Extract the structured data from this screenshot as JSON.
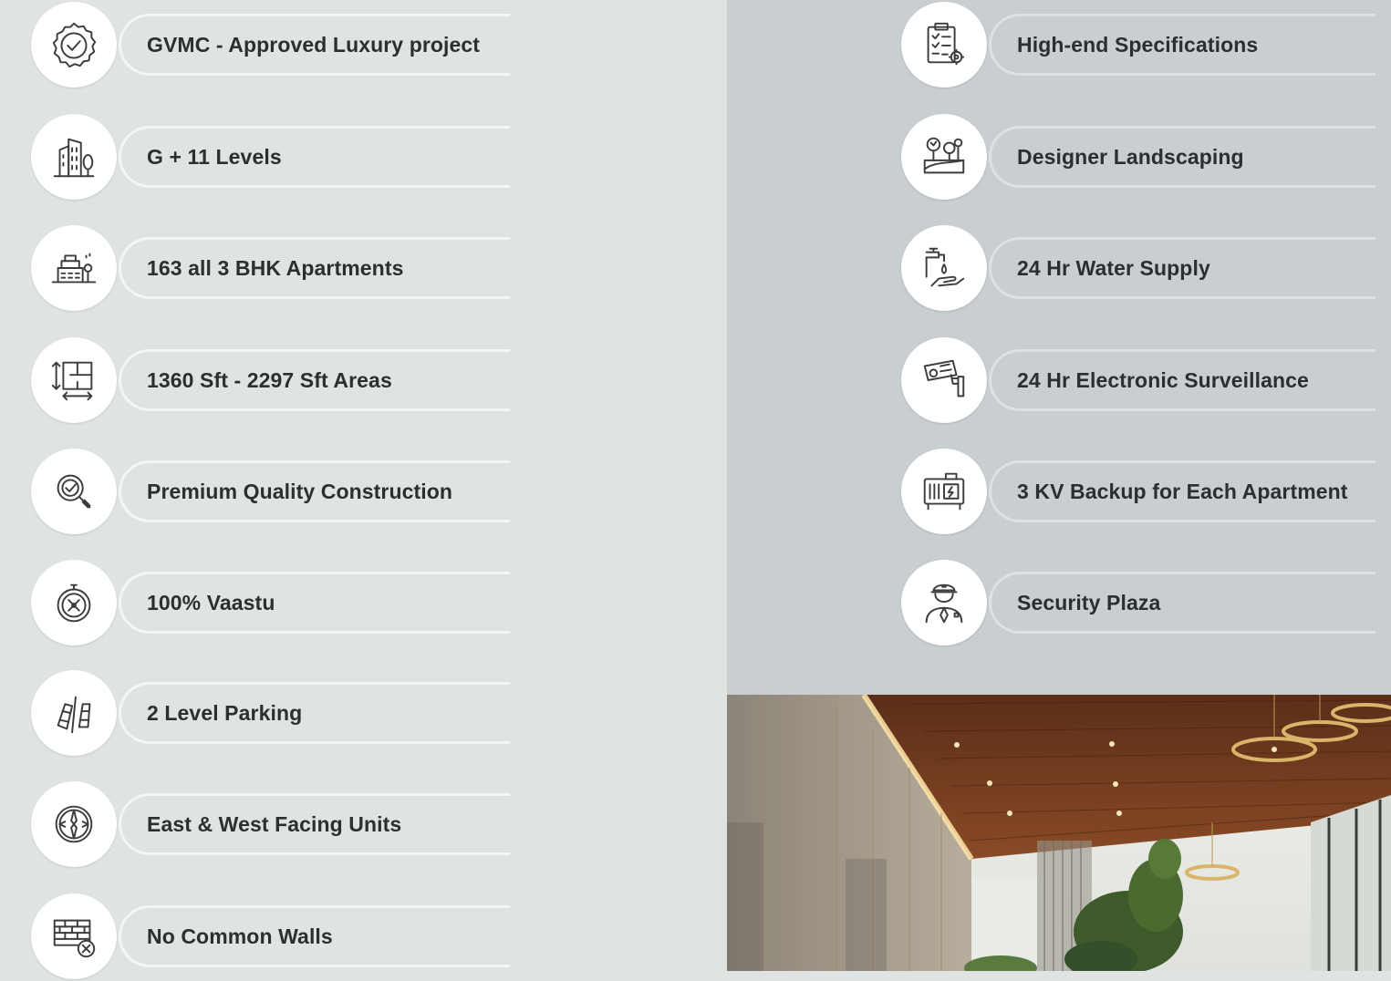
{
  "features_left": [
    {
      "label": "GVMC - Approved Luxury project",
      "icon": "approved-badge-icon"
    },
    {
      "label": "G + 11 Levels",
      "icon": "building-icon"
    },
    {
      "label": "163 all 3 BHK Apartments",
      "icon": "apartments-icon"
    },
    {
      "label": "1360 Sft - 2297 Sft Areas",
      "icon": "floor-area-icon"
    },
    {
      "label": "Premium Quality Construction",
      "icon": "quality-magnifier-icon"
    },
    {
      "label": "100% Vaastu",
      "icon": "compass-icon"
    },
    {
      "label": "2 Level Parking",
      "icon": "parking-cars-icon"
    },
    {
      "label": "East & West Facing Units",
      "icon": "direction-compass-icon"
    },
    {
      "label": "No Common Walls",
      "icon": "no-common-wall-icon"
    }
  ],
  "features_right": [
    {
      "label": "High-end Specifications",
      "icon": "specifications-clipboard-icon"
    },
    {
      "label": "Designer Landscaping",
      "icon": "landscaping-icon"
    },
    {
      "label": "24 Hr Water Supply",
      "icon": "water-tap-icon"
    },
    {
      "label": "24 Hr Electronic Surveillance",
      "icon": "cctv-camera-icon"
    },
    {
      "label": "3 KV Backup for Each Apartment",
      "icon": "generator-icon"
    },
    {
      "label": "Security Plaza",
      "icon": "security-guard-icon"
    }
  ],
  "colors": {
    "left_background": "#dfe3e2",
    "right_background": "#c9ced0",
    "icon_circle": "#ffffff",
    "text": "#2c2e30",
    "icon_stroke": "#3a3c3e"
  }
}
